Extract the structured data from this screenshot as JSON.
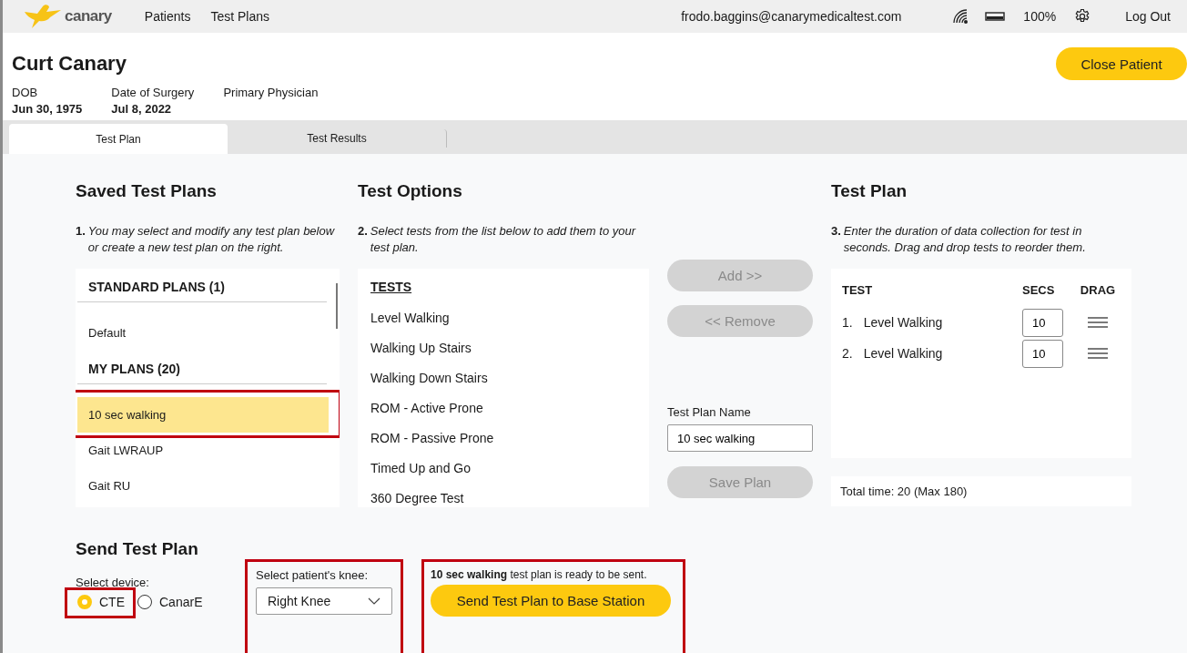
{
  "nav": {
    "logo_text": "canary",
    "links": [
      {
        "label": "Patients"
      },
      {
        "label": "Test Plans"
      }
    ],
    "user_email": "frodo.baggins@canarymedicaltest.com",
    "battery_text": "100%",
    "logout": "Log Out"
  },
  "patient": {
    "name": "Curt Canary",
    "close_button": "Close Patient",
    "fields": [
      {
        "label": "DOB",
        "value": "Jun 30, 1975"
      },
      {
        "label": "Date of Surgery",
        "value": "Jul 8, 2022"
      },
      {
        "label": "Primary Physician"
      }
    ]
  },
  "tabs": [
    {
      "label": "Test Plan",
      "selected": true
    },
    {
      "label": "Test Results",
      "selected": false
    }
  ],
  "saved_plans": {
    "title": "Saved Test Plans",
    "step": "1.",
    "instruction": "You may select and modify any test plan below or create a new test plan on the right.",
    "groups": [
      {
        "heading": "STANDARD PLANS (1)",
        "items": [
          {
            "label": "Default",
            "selected": false,
            "highlighted": false
          }
        ]
      },
      {
        "heading": "MY PLANS (20)",
        "items": [
          {
            "label": "10 sec walking",
            "selected": true,
            "highlighted": true
          },
          {
            "label": "Gait LWRAUP",
            "selected": false,
            "highlighted": false
          },
          {
            "label": "Gait RU",
            "selected": false,
            "highlighted": false
          }
        ]
      }
    ]
  },
  "test_options": {
    "title": "Test Options",
    "step": "2.",
    "instruction": "Select tests from the list below to add them to your test plan.",
    "list_heading": "TESTS",
    "tests": [
      "Level Walking",
      "Walking Up Stairs",
      "Walking Down Stairs",
      "ROM - Active Prone",
      "ROM - Passive Prone",
      "Timed Up and Go",
      "360 Degree Test"
    ]
  },
  "actions": {
    "add": {
      "label": "Add >>",
      "disabled": true
    },
    "remove": {
      "label": "<< Remove",
      "disabled": true
    },
    "name_label": "Test Plan Name",
    "name_value": "10 sec walking",
    "save": {
      "label": "Save Plan",
      "disabled": true
    }
  },
  "test_plan": {
    "title": "Test Plan",
    "step": "3.",
    "instruction": "Enter the duration of data collection for test in seconds. Drag and drop tests to reorder them.",
    "columns": [
      "TEST",
      "SECS",
      "DRAG"
    ],
    "rows": [
      {
        "number": "1.",
        "test": "Level Walking",
        "secs": "10"
      },
      {
        "number": "2.",
        "test": "Level Walking",
        "secs": "10"
      }
    ],
    "total": "Total time: 20 (Max 180)"
  },
  "send": {
    "title": "Send Test Plan",
    "device": {
      "label": "Select device:",
      "highlighted": true,
      "options": [
        {
          "label": "CTE",
          "selected": true
        },
        {
          "label": "CanarE",
          "selected": false
        }
      ]
    },
    "knee": {
      "label": "Select patient's knee:",
      "value": "Right Knee",
      "highlighted": true
    },
    "status": {
      "message": "**10 sec walking** test plan is ready to be sent.",
      "button": "Send Test Plan to Base Station",
      "highlighted": true
    }
  }
}
